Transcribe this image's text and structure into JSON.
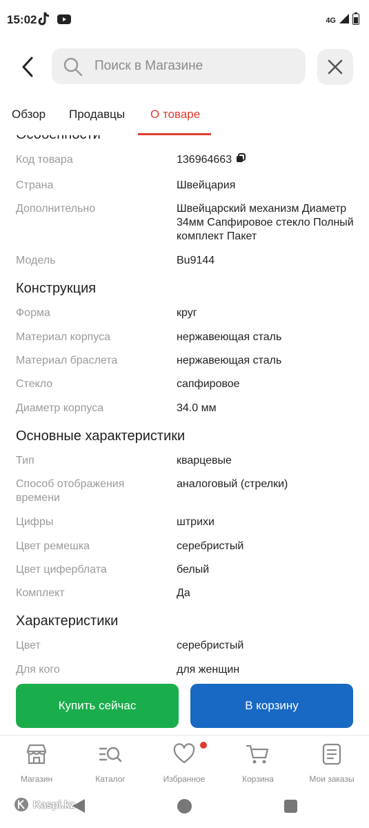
{
  "status": {
    "time": "15:02",
    "network": "4G"
  },
  "search": {
    "placeholder": "Поиск в Магазине"
  },
  "tabs": [
    {
      "label": "Обзор",
      "active": false
    },
    {
      "label": "Продавцы",
      "active": false
    },
    {
      "label": "О товаре",
      "active": true
    }
  ],
  "sections": {
    "features": {
      "title": "Особенности",
      "rows": [
        {
          "label": "Код товара",
          "value": "136964663"
        },
        {
          "label": "Страна",
          "value": "Швейцария"
        },
        {
          "label": "Дополнительно",
          "value": "Швейцарский механизм Диаметр 34мм Сапфировое стекло Полный комплект Пакет"
        },
        {
          "label": "Модель",
          "value": "Bu9144"
        }
      ]
    },
    "construction": {
      "title": "Конструкция",
      "rows": [
        {
          "label": "Форма",
          "value": "круг"
        },
        {
          "label": "Материал корпуса",
          "value": "нержавеющая сталь"
        },
        {
          "label": "Материал браслета",
          "value": "нержавеющая сталь"
        },
        {
          "label": "Стекло",
          "value": "сапфировое"
        },
        {
          "label": "Диаметр корпуса",
          "value": "34.0 мм"
        }
      ]
    },
    "main": {
      "title": "Основные характеристики",
      "rows": [
        {
          "label": "Тип",
          "value": "кварцевые"
        },
        {
          "label": "Способ отображения времени",
          "value": "аналоговый (стрелки)"
        },
        {
          "label": "Цифры",
          "value": "штрихи"
        },
        {
          "label": "Цвет ремешка",
          "value": "серебристый"
        },
        {
          "label": "Цвет циферблата",
          "value": "белый"
        },
        {
          "label": "Комплект",
          "value": "Да"
        }
      ]
    },
    "characteristics": {
      "title": "Характеристики",
      "rows": [
        {
          "label": "Цвет",
          "value": "серебристый"
        },
        {
          "label": "Для кого",
          "value": "для женщин"
        }
      ]
    }
  },
  "actions": {
    "buy_label": "Купить сейчас",
    "cart_label": "В корзину"
  },
  "bottom_nav": [
    {
      "label": "Магазин",
      "icon": "store-icon"
    },
    {
      "label": "Каталог",
      "icon": "catalog-icon"
    },
    {
      "label": "Избранное",
      "icon": "heart-icon",
      "badge": true
    },
    {
      "label": "Корзина",
      "icon": "cart-icon"
    },
    {
      "label": "Мои заказы",
      "icon": "orders-icon"
    }
  ],
  "watermark": "Kaspi.kz",
  "colors": {
    "accent": "#e23a2e",
    "buy": "#1aad4c",
    "cart": "#1769c4"
  }
}
